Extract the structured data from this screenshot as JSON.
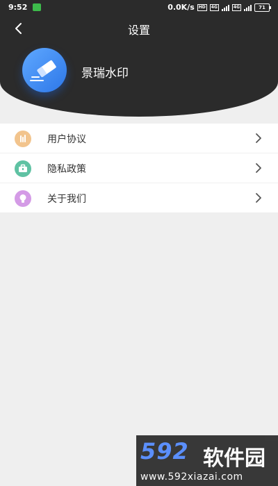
{
  "status_bar": {
    "time": "9:52",
    "network_speed": "0.0K/s",
    "hd_badge": "HD",
    "net_badge": "4G",
    "battery": "71"
  },
  "header": {
    "title": "设置",
    "app_name": "景瑞水印"
  },
  "menu": {
    "items": [
      {
        "label": "用户协议",
        "icon": "document-icon",
        "color": "#f2c48d"
      },
      {
        "label": "隐私政策",
        "icon": "briefcase-icon",
        "color": "#5fc2a3"
      },
      {
        "label": "关于我们",
        "icon": "lightbulb-icon",
        "color": "#d49be6"
      }
    ]
  },
  "watermark": {
    "brand_num": "592",
    "brand_cn": "软件园",
    "url": "www.592xiazai.com"
  },
  "colors": {
    "header_bg": "#2b2b2b",
    "page_bg": "#efefef",
    "logo_blue": "#2d77e8"
  }
}
